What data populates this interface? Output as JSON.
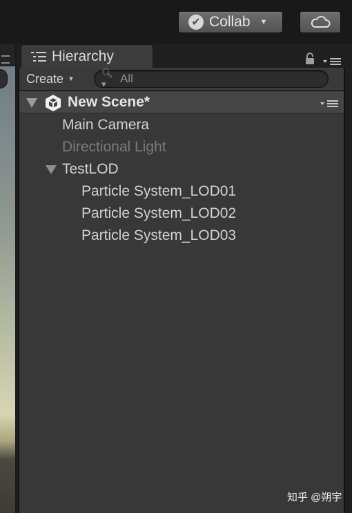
{
  "toolbar": {
    "collab_label": "Collab"
  },
  "hierarchy": {
    "tab_label": "Hierarchy",
    "create_label": "Create",
    "search_placeholder": "All",
    "scene": {
      "name": "New Scene*"
    },
    "items": [
      {
        "label": "Main Camera",
        "active": true
      },
      {
        "label": "Directional Light",
        "active": false
      },
      {
        "label": "TestLOD",
        "active": true,
        "expanded": true
      },
      {
        "label": "Particle System_LOD01",
        "active": true
      },
      {
        "label": "Particle System_LOD02",
        "active": true
      },
      {
        "label": "Particle System_LOD03",
        "active": true
      }
    ]
  },
  "watermark": "知乎 @朔宇",
  "icons": {
    "collab": "check-circle-icon",
    "cloud": "cloud-icon",
    "tab": "list-icon",
    "lock": "lock-icon",
    "menu": "panel-menu-icon",
    "scene": "unity-logo-icon",
    "search": "search-icon"
  },
  "colors": {
    "panel_bg": "#383838",
    "scene_row_bg": "#454545",
    "disabled_text": "#7b7b7b"
  }
}
